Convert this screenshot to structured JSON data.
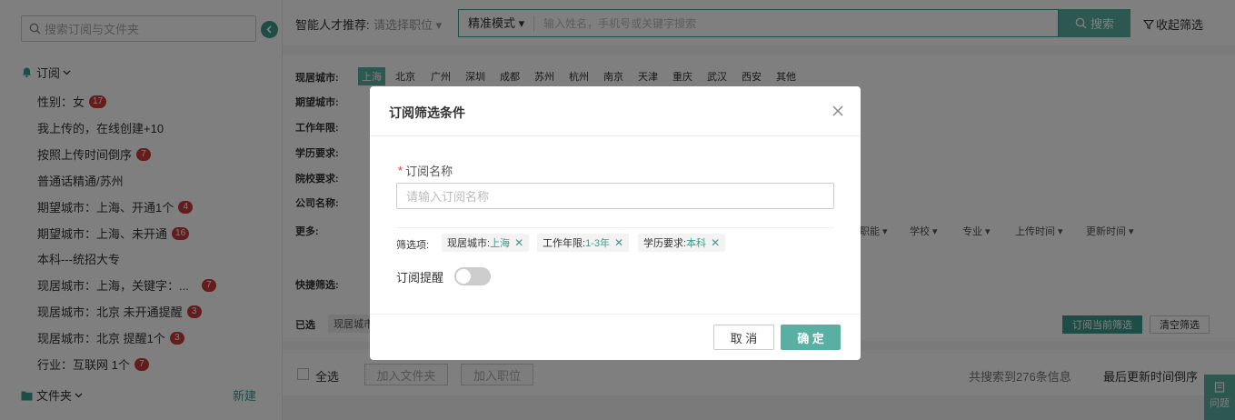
{
  "sidebar": {
    "search_placeholder": "搜索订阅与文件夹",
    "subscriptions_title": "订阅",
    "items": [
      {
        "label": "性别：女",
        "badge": "17"
      },
      {
        "label": "我上传的，在线创建+10",
        "badge": ""
      },
      {
        "label": "按照上传时间倒序",
        "badge": "7"
      },
      {
        "label": "普通话精通/苏州",
        "badge": ""
      },
      {
        "label": "期望城市：上海、开通1个",
        "badge": "4"
      },
      {
        "label": "期望城市：上海、未开通",
        "badge": "16"
      },
      {
        "label": "本科---统招大专",
        "badge": ""
      },
      {
        "label": "现居城市：上海，关键字：...",
        "badge": "7"
      },
      {
        "label": "现居城市：北京 未开通提醒",
        "badge": "3"
      },
      {
        "label": "现居城市：北京 提醒1个",
        "badge": "3"
      },
      {
        "label": "行业：互联网 1个",
        "badge": "7"
      }
    ],
    "folders_title": "文件夹",
    "new_label": "新建"
  },
  "topbar": {
    "ai_label": "智能人才推荐:",
    "ai_select": "请选择职位",
    "mode": "精准模式",
    "search_placeholder": "输入姓名，手机号或关键字搜索",
    "search_button": "搜索",
    "collapse_filter": "收起筛选"
  },
  "filters": {
    "labels": [
      "现居城市:",
      "期望城市:",
      "工作年限:",
      "学历要求:",
      "院校要求:",
      "公司名称:",
      "更多:",
      "快捷筛选:"
    ],
    "cities": [
      "上海",
      "北京",
      "广州",
      "深圳",
      "成都",
      "苏州",
      "杭州",
      "南京",
      "天津",
      "重庆",
      "武汉",
      "西安",
      "其他"
    ],
    "active_city": "上海",
    "more_dropdowns": [
      "职能",
      "学校",
      "专业",
      "上传时间",
      "更新时间"
    ],
    "selected_label": "已选",
    "selected_tag": "现居城市",
    "subscribe_button": "订阅当前筛选",
    "clear_button": "清空筛选"
  },
  "listbar": {
    "select_all": "全选",
    "add_folder": "加入文件夹",
    "add_job": "加入职位",
    "total": "共搜索到276条信息",
    "sort": "最后更新时间倒序",
    "help": "问题"
  },
  "modal": {
    "title": "订阅筛选条件",
    "name_label": "订阅名称",
    "name_placeholder": "请输入订阅名称",
    "filter_items_label": "筛选项:",
    "tags": [
      {
        "key": "现居城市:",
        "value": "上海"
      },
      {
        "key": "工作年限:",
        "value": "1-3年"
      },
      {
        "key": "学历要求:",
        "value": "本科"
      }
    ],
    "remind_label": "订阅提醒",
    "remind_on": false,
    "cancel": "取 消",
    "ok": "确 定"
  },
  "colors": {
    "accent": "#5aafa3",
    "accent_dark": "#3d9a8e",
    "badge": "#c73b3b"
  }
}
